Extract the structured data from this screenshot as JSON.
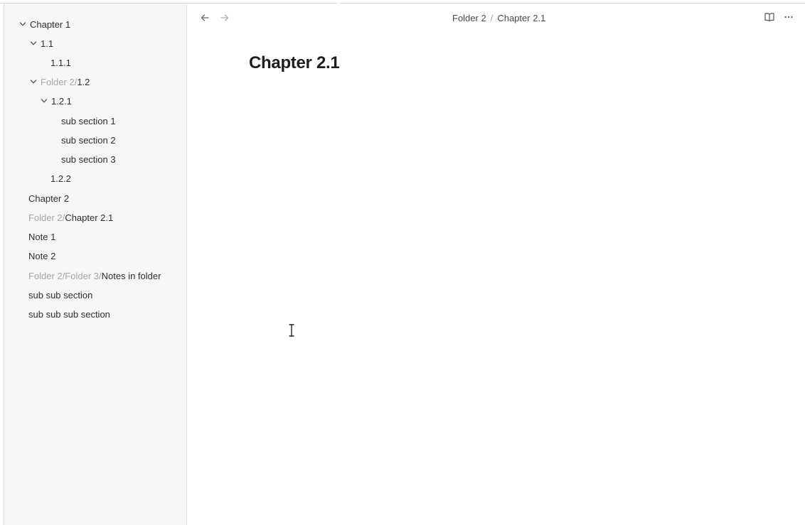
{
  "sidebar": {
    "items": [
      {
        "prefix": "",
        "label": "Chapter 1",
        "expanded": true
      },
      {
        "prefix": "",
        "label": "1.1",
        "expanded": true
      },
      {
        "prefix": "",
        "label": "1.1.1"
      },
      {
        "prefix": "Folder 2/",
        "label": "1.2",
        "expanded": true
      },
      {
        "prefix": "",
        "label": "1.2.1",
        "expanded": true
      },
      {
        "prefix": "",
        "label": "sub section 1"
      },
      {
        "prefix": "",
        "label": "sub section 2"
      },
      {
        "prefix": "",
        "label": "sub section 3"
      },
      {
        "prefix": "",
        "label": "1.2.2"
      },
      {
        "prefix": "",
        "label": "Chapter 2"
      },
      {
        "prefix": "Folder 2/",
        "label": "Chapter 2.1"
      },
      {
        "prefix": "",
        "label": "Note 1"
      },
      {
        "prefix": "",
        "label": "Note 2"
      },
      {
        "prefix": "Folder 2/Folder 3/",
        "label": "Notes in folder"
      },
      {
        "prefix": "",
        "label": "sub sub section"
      },
      {
        "prefix": "",
        "label": "sub sub sub section"
      }
    ]
  },
  "header": {
    "breadcrumb": [
      "Folder 2",
      "Chapter 2.1"
    ],
    "separator": "/",
    "icons": {
      "back": "arrow-left-icon",
      "forward": "arrow-right-icon",
      "reading_view": "book-open-icon",
      "more": "more-options-icon"
    }
  },
  "main": {
    "title": "Chapter 2.1"
  }
}
